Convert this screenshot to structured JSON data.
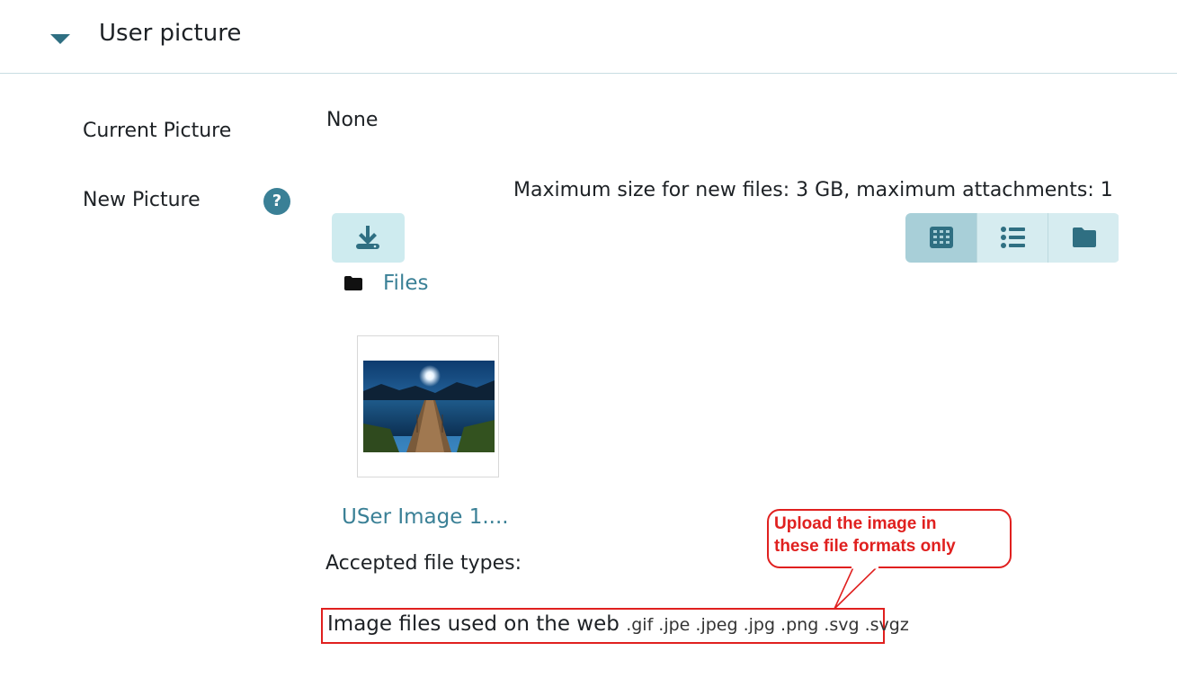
{
  "section": {
    "title": "User picture"
  },
  "current_picture": {
    "label": "Current Picture",
    "value": "None"
  },
  "new_picture": {
    "label": "New Picture",
    "help_glyph": "?",
    "limits": "Maximum size for new files: 3 GB, maximum attachments: 1",
    "breadcrumb_folder": "Files",
    "file": {
      "name": "USer Image 1...."
    }
  },
  "accepted": {
    "label": "Accepted file types:",
    "group_name": "Image files used on the web",
    "extensions": ".gif .jpe .jpeg .jpg .png .svg .svgz"
  },
  "annotation": {
    "line1": "Upload the image in",
    "line2": "these file formats only"
  },
  "colors": {
    "accent": "#3a8096",
    "button_bg": "#ceebef",
    "annotation_red": "#e0201f"
  },
  "icons": {
    "toggle": "caret-down-icon",
    "help": "question-circle-icon",
    "upload": "download-icon",
    "views": [
      "grid-icon",
      "list-icon",
      "folder-icon"
    ],
    "breadcrumb": "folder-icon"
  }
}
